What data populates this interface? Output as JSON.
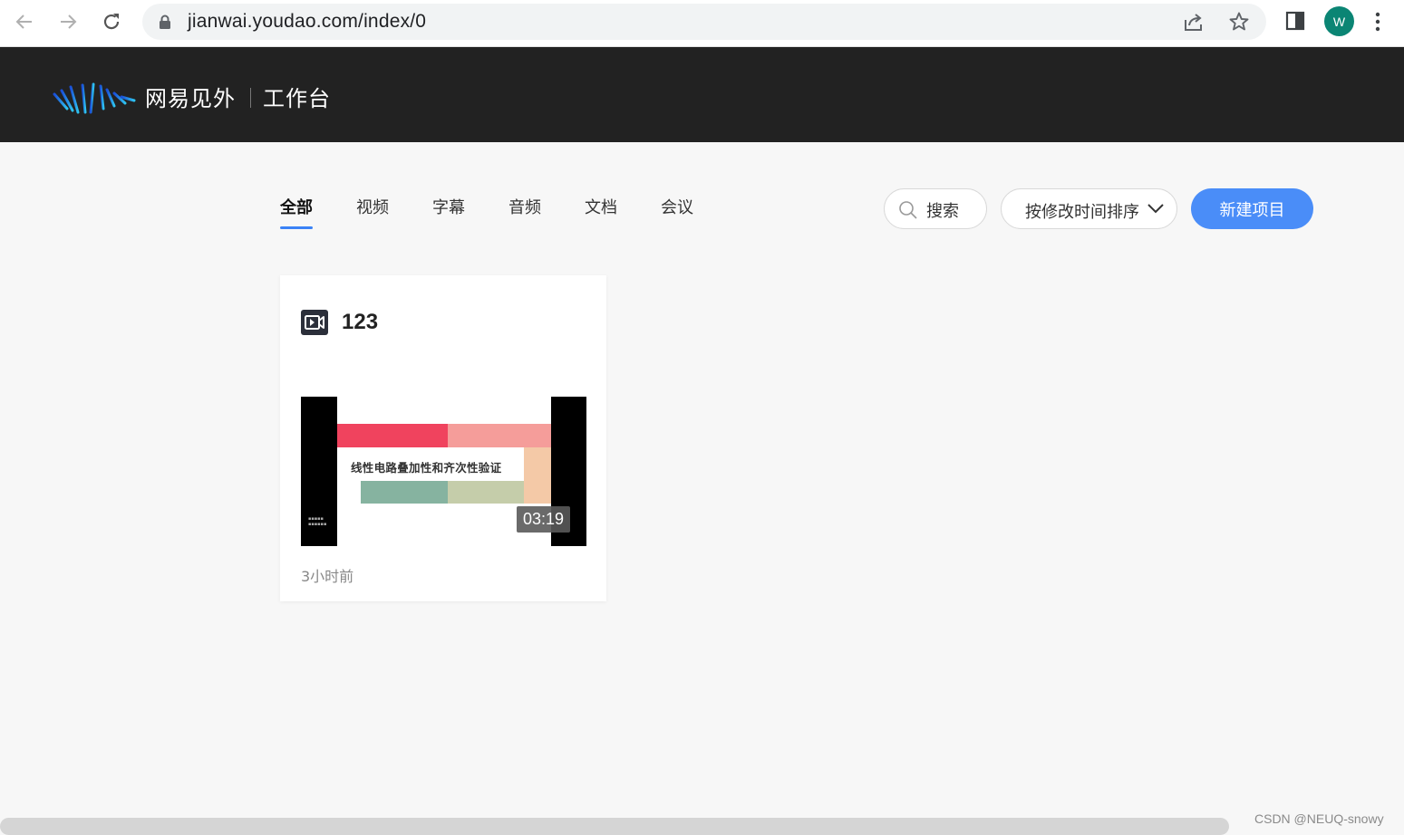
{
  "browser": {
    "url": "jianwai.youdao.com/index/0",
    "profile_initial": "W",
    "profile_color": "#0b8574"
  },
  "header": {
    "brand_name": "网易见外",
    "section_name": "工作台",
    "background": "#222222"
  },
  "tabs": [
    {
      "label": "全部",
      "active": true
    },
    {
      "label": "视频",
      "active": false
    },
    {
      "label": "字幕",
      "active": false
    },
    {
      "label": "音频",
      "active": false
    },
    {
      "label": "文档",
      "active": false
    },
    {
      "label": "会议",
      "active": false
    }
  ],
  "toolbar": {
    "search_label": "搜索",
    "sort_label": "按修改时间排序",
    "new_project_label": "新建项目",
    "accent_color": "#4a8df8"
  },
  "projects": [
    {
      "type_icon": "video-icon",
      "title": "123",
      "thumbnail_caption": "线性电路叠加性和齐次性验证",
      "duration": "03:19",
      "modified": "3小时前"
    }
  ],
  "watermark": "CSDN @NEUQ-snowy"
}
